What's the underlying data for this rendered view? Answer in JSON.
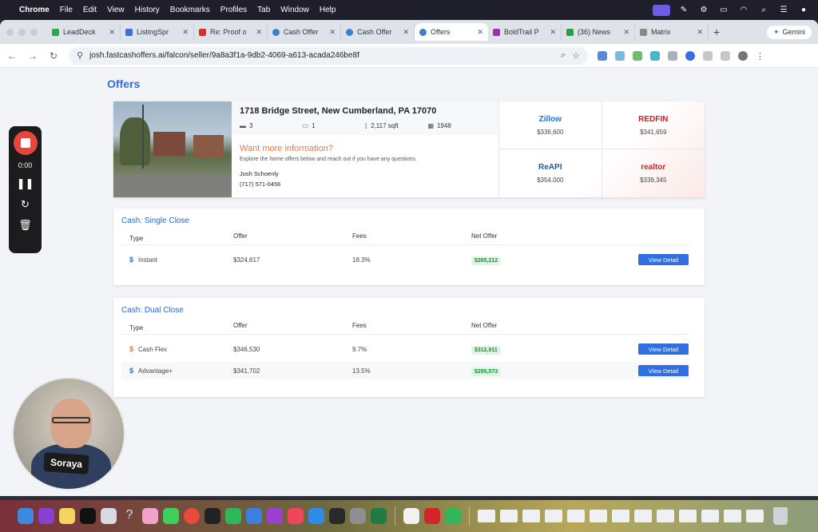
{
  "menubar": {
    "app": "Chrome",
    "items": [
      "File",
      "Edit",
      "View",
      "History",
      "Bookmarks",
      "Profiles",
      "Tab",
      "Window",
      "Help"
    ]
  },
  "browser": {
    "tabs": [
      {
        "label": "LeadDeck",
        "color": "#2aa84a"
      },
      {
        "label": "ListingSpr",
        "color": "#3b6fd6"
      },
      {
        "label": "Re: Proof o",
        "color": "#d93025"
      },
      {
        "label": "Cash Offer",
        "color": "#3b7fd0"
      },
      {
        "label": "Cash Offer",
        "color": "#3b7fd0"
      },
      {
        "label": "Offers",
        "color": "#3b7fd0"
      },
      {
        "label": "BoldTrail P",
        "color": "#9b2fae"
      },
      {
        "label": "(36) News",
        "color": "#2a9d4a"
      },
      {
        "label": "Matrix",
        "color": "#888888"
      }
    ],
    "gemini_label": "Gemini",
    "url": "josh.fastcashoffers.ai/falcon/seller/9a8a3f1a-9db2-4069-a613-acada246be8f"
  },
  "page": {
    "title": "Offers",
    "property": {
      "address": "1718 Bridge Street, New Cumberland, PA 17070",
      "beds": "3",
      "baths": "1",
      "sqft": "2,117 sqft",
      "year": "1948",
      "more_info_heading": "Want more information?",
      "more_info_text": "Explore the home offers below and reach out if you have any questions.",
      "agent_name": "Josh Schoenly",
      "agent_phone": "(717) 571-0456"
    },
    "estimates": [
      {
        "brand": "Zillow",
        "value": "$336,600",
        "color": "#1277e1"
      },
      {
        "brand": "REDFIN",
        "value": "$341,659",
        "color": "#c82021"
      },
      {
        "brand": "ReAPI",
        "value": "$354,000",
        "color": "#1b5aa8"
      },
      {
        "brand": "realtor",
        "value": "$339,345",
        "color": "#d92228"
      }
    ],
    "single_close": {
      "title": "Cash: Single Close",
      "headers": [
        "Type",
        "Offer",
        "Fees",
        "Net Offer"
      ],
      "rows": [
        {
          "type": "Instant",
          "offer": "$324,617",
          "fees": "18.3%",
          "net": "$265,212",
          "button": "View Detail",
          "icon_color": "#2f6fe0"
        }
      ]
    },
    "dual_close": {
      "title": "Cash: Dual Close",
      "headers": [
        "Type",
        "Offer",
        "Fees",
        "Net Offer"
      ],
      "rows": [
        {
          "type": "Cash Flex",
          "offer": "$346,530",
          "fees": "9.7%",
          "net": "$312,911",
          "button": "View Detail",
          "icon_color": "#e07a4a"
        },
        {
          "type": "Advantage+",
          "offer": "$341,702",
          "fees": "13.5%",
          "net": "$295,573",
          "button": "View Detail",
          "icon_color": "#2f6fe0"
        }
      ]
    }
  },
  "recorder": {
    "time": "0:00"
  },
  "webcam": {
    "sign_text": "Soraya"
  }
}
